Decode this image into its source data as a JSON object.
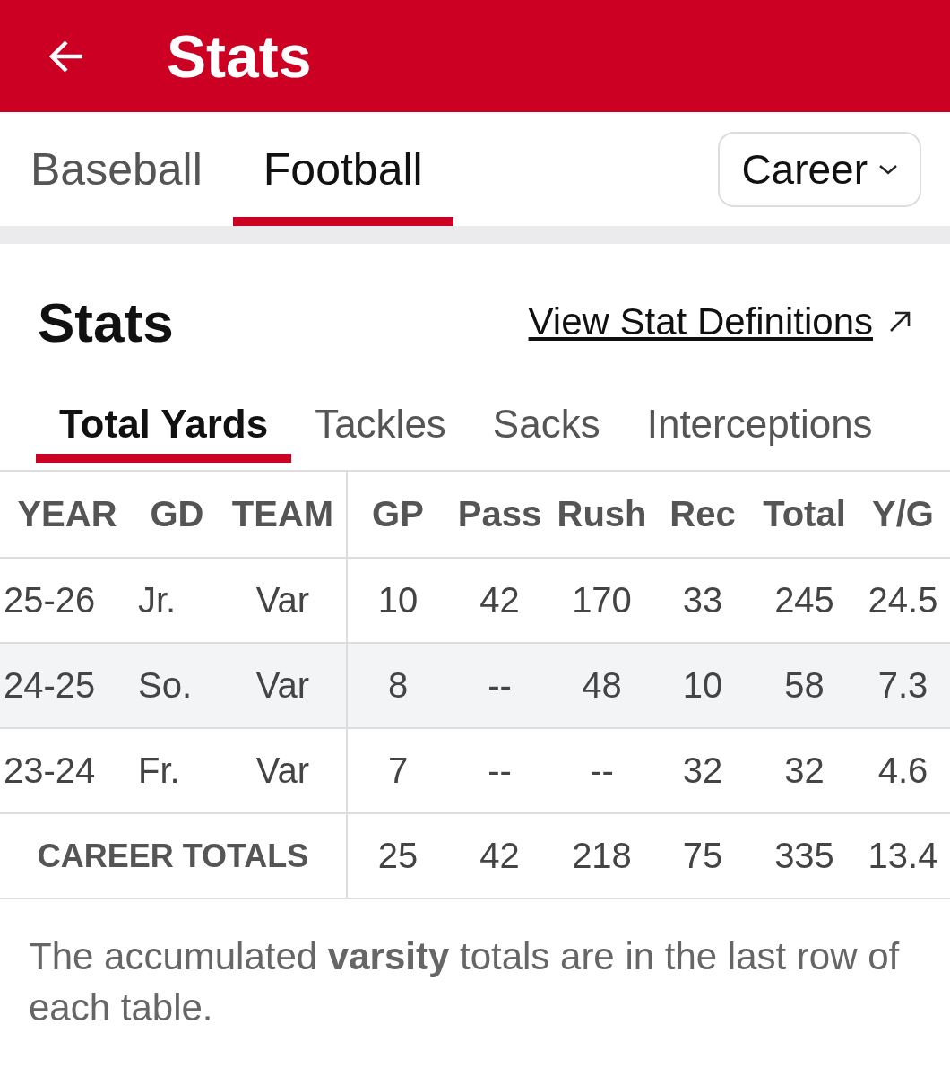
{
  "header": {
    "title": "Stats"
  },
  "sport_tabs": [
    {
      "label": "Baseball",
      "selected": false
    },
    {
      "label": "Football",
      "selected": true
    }
  ],
  "period_dropdown": {
    "value": "Career"
  },
  "section": {
    "title": "Stats",
    "link": "View Stat Definitions"
  },
  "stat_tabs": [
    {
      "label": "Total Yards",
      "selected": true
    },
    {
      "label": "Tackles",
      "selected": false
    },
    {
      "label": "Sacks",
      "selected": false
    },
    {
      "label": "Interceptions",
      "selected": false
    }
  ],
  "table": {
    "columns": [
      "YEAR",
      "GD",
      "TEAM",
      "GP",
      "Pass",
      "Rush",
      "Rec",
      "Total",
      "Y/G"
    ],
    "rows": [
      {
        "cells": [
          "25-26",
          "Jr.",
          "Var",
          "10",
          "42",
          "170",
          "33",
          "245",
          "24.5"
        ]
      },
      {
        "cells": [
          "24-25",
          "So.",
          "Var",
          "8",
          "--",
          "48",
          "10",
          "58",
          "7.3"
        ]
      },
      {
        "cells": [
          "23-24",
          "Fr.",
          "Var",
          "7",
          "--",
          "--",
          "32",
          "32",
          "4.6"
        ]
      }
    ],
    "totals": {
      "label": "CAREER TOTALS",
      "cells": [
        "25",
        "42",
        "218",
        "75",
        "335",
        "13.4"
      ]
    }
  },
  "footnote": "The accumulated **varsity** totals are in the last row of each table."
}
